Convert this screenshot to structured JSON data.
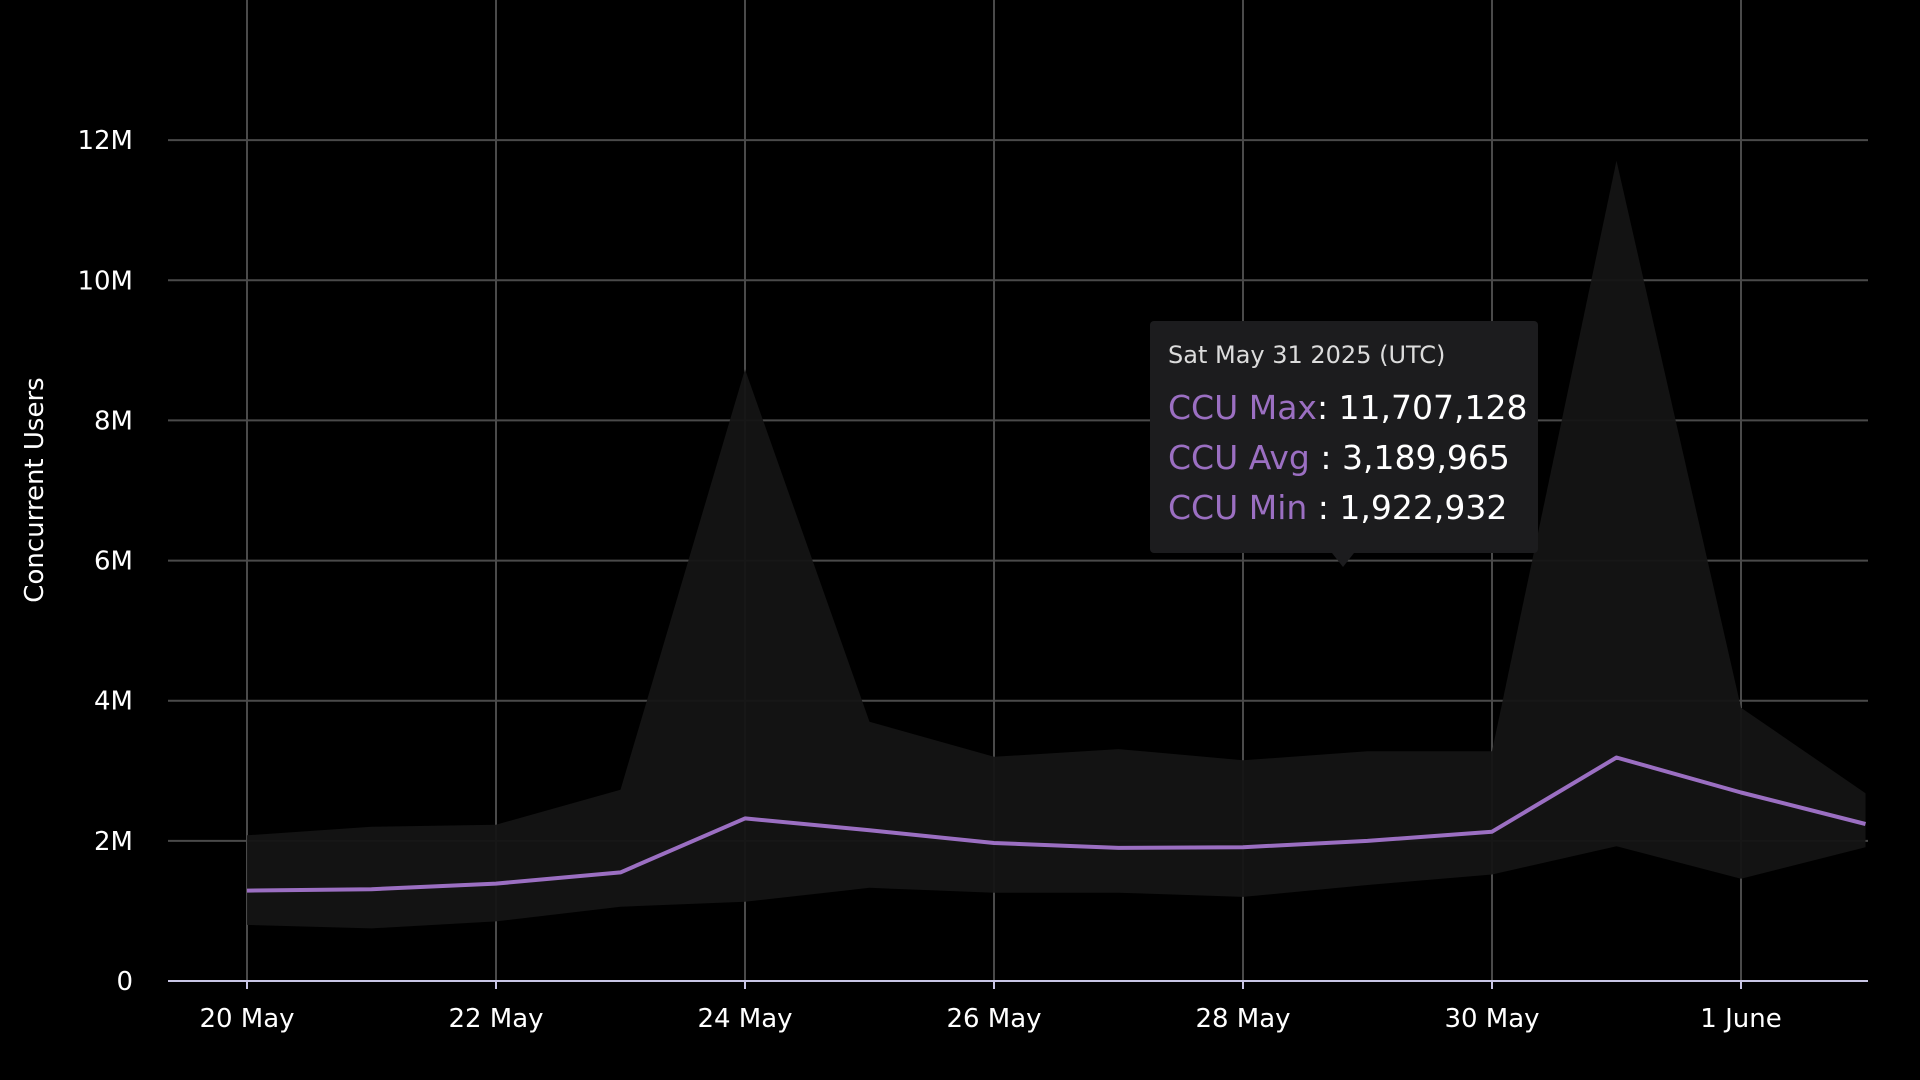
{
  "chart_data": {
    "type": "area",
    "ylabel": "Concurrent Users",
    "xlabel": "",
    "ylim": [
      0,
      14000000
    ],
    "y_ticks": [
      {
        "value": 0,
        "label": "0"
      },
      {
        "value": 2000000,
        "label": "2M"
      },
      {
        "value": 4000000,
        "label": "4M"
      },
      {
        "value": 6000000,
        "label": "6M"
      },
      {
        "value": 8000000,
        "label": "8M"
      },
      {
        "value": 10000000,
        "label": "10M"
      },
      {
        "value": 12000000,
        "label": "12M"
      }
    ],
    "x_ticks": [
      {
        "date": "2025-05-20",
        "label": "20 May"
      },
      {
        "date": "2025-05-22",
        "label": "22 May"
      },
      {
        "date": "2025-05-24",
        "label": "24 May"
      },
      {
        "date": "2025-05-26",
        "label": "26 May"
      },
      {
        "date": "2025-05-28",
        "label": "28 May"
      },
      {
        "date": "2025-05-30",
        "label": "30 May"
      },
      {
        "date": "2025-06-01",
        "label": "1 June"
      }
    ],
    "x_range": [
      "2025-05-19",
      "2025-06-02"
    ],
    "x": [
      "2025-05-20",
      "2025-05-21",
      "2025-05-22",
      "2025-05-23",
      "2025-05-24",
      "2025-05-25",
      "2025-05-26",
      "2025-05-27",
      "2025-05-28",
      "2025-05-29",
      "2025-05-30",
      "2025-05-31",
      "2025-06-01",
      "2025-06-02"
    ],
    "series": [
      {
        "name": "CCU Max",
        "values": [
          2080000,
          2200000,
          2230000,
          2730000,
          8730000,
          3700000,
          3200000,
          3310000,
          3150000,
          3280000,
          3280000,
          11707128,
          3900000,
          2680000
        ]
      },
      {
        "name": "CCU Avg",
        "values": [
          1290000,
          1310000,
          1390000,
          1550000,
          2320000,
          2150000,
          1970000,
          1900000,
          1910000,
          2000000,
          2130000,
          3189965,
          2690000,
          2240000
        ]
      },
      {
        "name": "CCU Min",
        "values": [
          800000,
          750000,
          850000,
          1060000,
          1130000,
          1330000,
          1260000,
          1260000,
          1200000,
          1370000,
          1520000,
          1922932,
          1460000,
          1910000
        ]
      }
    ],
    "grid": true,
    "colors": {
      "background": "#000000",
      "grid": "#4a4a4a",
      "baseline": "#c9c6e6",
      "band": "#141414",
      "avg_line": "#9b6fc2",
      "tooltip_bg": "#1c1c1e",
      "tooltip_label": "#9b6fc2"
    }
  },
  "tooltip": {
    "date": "Sat May 31 2025 (UTC)",
    "rows": [
      {
        "label": "CCU Max",
        "value": "11,707,128"
      },
      {
        "label": "CCU Avg",
        "value": "3,189,965"
      },
      {
        "label": "CCU Min",
        "value": "1,922,932"
      }
    ]
  }
}
